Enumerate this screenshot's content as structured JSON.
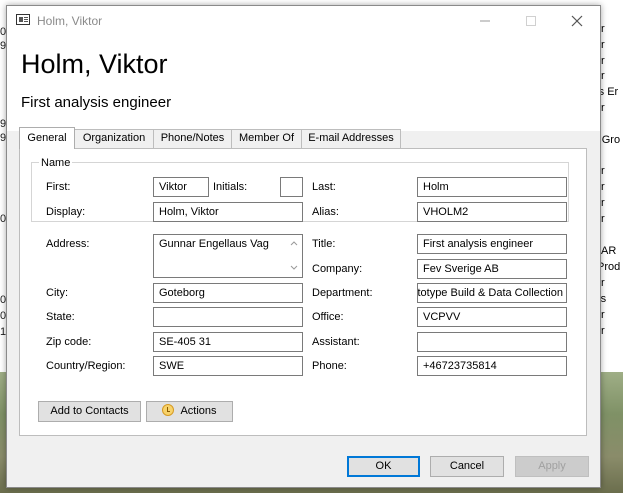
{
  "window": {
    "title": "Holm, Viktor",
    "icon": "contact-card-icon",
    "controls": [
      "minimize-icon",
      "maximize-icon",
      "close-icon"
    ]
  },
  "header": {
    "name": "Holm, Viktor",
    "job_title": "First analysis engineer"
  },
  "tabs": [
    {
      "label": "General",
      "active": true
    },
    {
      "label": "Organization"
    },
    {
      "label": "Phone/Notes"
    },
    {
      "label": "Member Of"
    },
    {
      "label": "E-mail Addresses"
    }
  ],
  "name_group": {
    "legend": "Name",
    "first_label": "First:",
    "first_value": "Viktor",
    "initials_label": "Initials:",
    "initials_value": "",
    "last_label": "Last:",
    "last_value": "Holm",
    "display_label": "Display:",
    "display_value": "Holm, Viktor",
    "alias_label": "Alias:",
    "alias_value": "VHOLM2"
  },
  "address": {
    "address_label": "Address:",
    "address_value": "Gunnar Engellaus Vag",
    "city_label": "City:",
    "city_value": "Goteborg",
    "state_label": "State:",
    "state_value": "",
    "zip_label": "Zip code:",
    "zip_value": "SE-405 31",
    "country_label": "Country/Region:",
    "country_value": "SWE"
  },
  "organization": {
    "title_label": "Title:",
    "title_value": "First analysis engineer",
    "company_label": "Company:",
    "company_value": "Fev Sverige AB",
    "department_label": "Department:",
    "department_value": "Prototype Build & Data Collection",
    "office_label": "Office:",
    "office_value": "VCPVV",
    "assistant_label": "Assistant:",
    "assistant_value": "",
    "phone_label": "Phone:",
    "phone_value": "+46723735814"
  },
  "buttons": {
    "add_to_contacts": "Add to Contacts",
    "actions": "Actions",
    "actions_icon": "clock-icon",
    "ok": "OK",
    "cancel": "Cancel",
    "apply": "Apply"
  },
  "background": {
    "left_fragments": [
      "00",
      "9",
      "9",
      "9",
      "06",
      "00",
      "00",
      "1"
    ],
    "right_fragments": [
      "r",
      "r",
      "r",
      "r",
      "rs Er",
      "r",
      "r Gro",
      "r",
      "r",
      "r",
      "r",
      "AR",
      "Prod",
      "r",
      "rs",
      "r",
      "r"
    ]
  }
}
